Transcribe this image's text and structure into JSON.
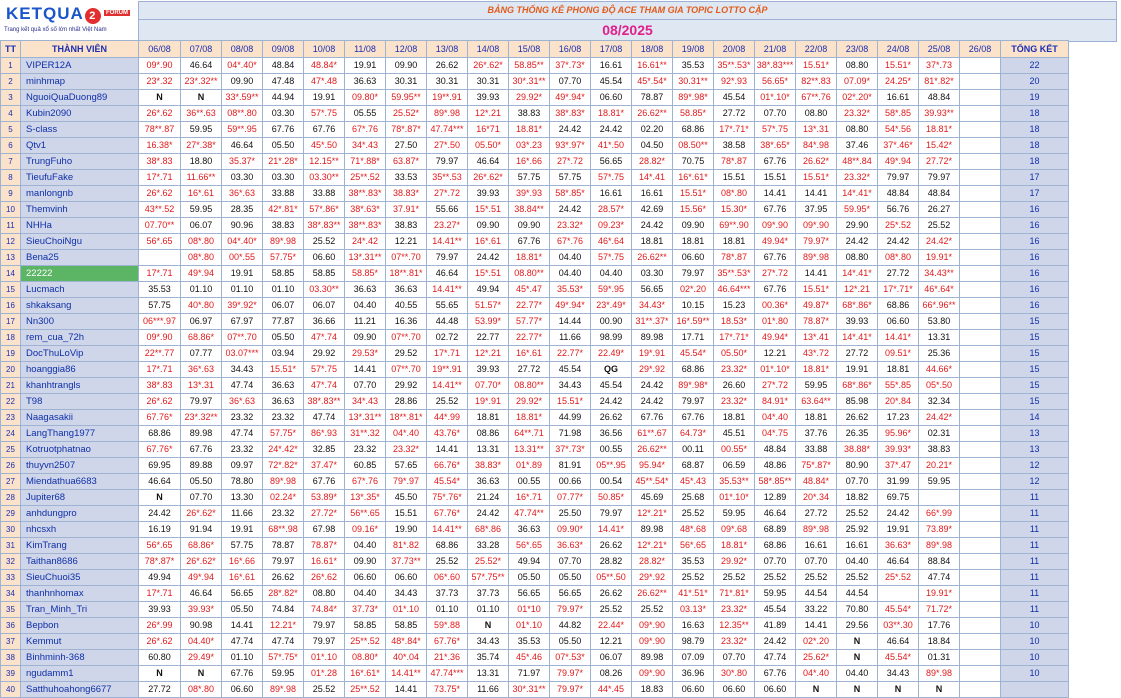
{
  "logo": {
    "brand": "KETQUA",
    "brand_num": "2",
    "forum": "FORUM",
    "tagline": "Trang kết quả xổ số lớn nhất Việt Nam"
  },
  "title": "BẢNG THỐNG KÊ PHONG ĐỘ ACE THAM GIA TOPIC  LOTTO CẶP",
  "month": "08/2025",
  "headers": {
    "tt": "TT",
    "member": "THÀNH VIÊN",
    "total": "TỔNG KẾT",
    "dates": [
      "06/08",
      "07/08",
      "08/08",
      "09/08",
      "10/08",
      "11/08",
      "12/08",
      "13/08",
      "14/08",
      "15/08",
      "16/08",
      "17/08",
      "18/08",
      "19/08",
      "20/08",
      "21/08",
      "22/08",
      "23/08",
      "24/08",
      "25/08",
      "26/08"
    ]
  },
  "colors": {
    "hit": "#e0191b",
    "miss": "#111111",
    "header_bg": "#fbe2cb",
    "name_bg": "#cfd6ea",
    "highlight": "#5cb565"
  },
  "rows": [
    {
      "tt": "1",
      "name": "VIPER12A",
      "cells": [
        "09*.90",
        "46.64",
        "04*.40*",
        "48.84",
        "48.84*",
        "19.91",
        "09.90",
        "26.62",
        "26*.62*",
        "58.85**",
        "37*.73*",
        "16.61",
        "16.61**",
        "35.53",
        "35**.53*",
        "38*.83***",
        "15.51*",
        "08.80",
        "15.51*",
        "37*.73",
        ""
      ],
      "total": "22"
    },
    {
      "tt": "2",
      "name": "minhmap",
      "cells": [
        "23*.32",
        "23*.32**",
        "09.90",
        "47.48",
        "47*.48",
        "36.63",
        "30.31",
        "30.31",
        "30.31",
        "30*.31**",
        "07.70",
        "45.54",
        "45*.54*",
        "30.31**",
        "92*.93",
        "56.65*",
        "82**.83",
        "07.09*",
        "24.25*",
        "81*.82*",
        ""
      ],
      "total": "20"
    },
    {
      "tt": "3",
      "name": "NguoiQuaDuong89",
      "cells": [
        "N",
        "N",
        "33*.59**",
        "44.94",
        "19.91",
        "09.80*",
        "59.95**",
        "19**.91",
        "39.93",
        "29.92*",
        "49*.94*",
        "06.60",
        "78.87",
        "89*.98*",
        "45.54",
        "01*.10*",
        "67**.76",
        "02*.20*",
        "16.61",
        "48.84",
        ""
      ],
      "total": "19"
    },
    {
      "tt": "4",
      "name": "Kubin2090",
      "cells": [
        "26*.62",
        "36**.63",
        "08**.80",
        "03.30",
        "57*.75",
        "05.55",
        "25.52*",
        "89*.98",
        "12*.21",
        "38.83",
        "38*.83*",
        "18.81*",
        "26.62**",
        "58.85*",
        "27.72",
        "07.70",
        "08.80",
        "23.32*",
        "58*.85",
        "39.93**",
        ""
      ],
      "total": "18"
    },
    {
      "tt": "5",
      "name": "S-class",
      "cells": [
        "78**.87",
        "59.95",
        "59**.95",
        "67.76",
        "67.76",
        "67*.76",
        "78*.87*",
        "47.74***",
        "16*71",
        "18.81*",
        "24.42",
        "24.42",
        "02.20",
        "68.86",
        "17*.71*",
        "57*.75",
        "13*.31",
        "08.80",
        "54*.56",
        "18.81*",
        ""
      ],
      "total": "18"
    },
    {
      "tt": "6",
      "name": "Qtv1",
      "cells": [
        "16.38*",
        "27*.38*",
        "46.64",
        "05.50",
        "45*.50",
        "34*.43",
        "27.50",
        "27*.50",
        "05.50*",
        "03*.23",
        "93*.97*",
        "41*.50",
        "04.50",
        "08.50**",
        "38.58",
        "38*.65*",
        "84*.98",
        "37.46",
        "37*.46*",
        "15.42*",
        ""
      ],
      "total": "18"
    },
    {
      "tt": "7",
      "name": "TrungFuho",
      "cells": [
        "38*.83",
        "18.80",
        "35.37*",
        "21*.28*",
        "12.15**",
        "71*.88*",
        "63.87*",
        "79.97",
        "46.64",
        "16*.66",
        "27*.72",
        "56.65",
        "28.82*",
        "70.75",
        "78*.87",
        "67.76",
        "26.62*",
        "48**.84",
        "49*.94",
        "27.72*",
        ""
      ],
      "total": "18"
    },
    {
      "tt": "8",
      "name": "TieufuFake",
      "cells": [
        "17*.71",
        "11.66**",
        "03.30",
        "03.30",
        "03.30**",
        "25**.52",
        "33.53",
        "35**.53",
        "26*.62*",
        "57.75",
        "57.75",
        "57*.75",
        "14*.41",
        "16*.61*",
        "15.51",
        "15.51",
        "15.51*",
        "23.32*",
        "79.97",
        "79.97",
        ""
      ],
      "total": "17"
    },
    {
      "tt": "9",
      "name": "manlongnb",
      "cells": [
        "26*.62",
        "16*.61",
        "36*.63",
        "33.88",
        "33.88",
        "38**.83*",
        "38.83*",
        "27*.72",
        "39.93",
        "39*.93",
        "58*.85*",
        "16.61",
        "16.61",
        "15.51*",
        "08*.80",
        "14.41",
        "14.41",
        "14*.41*",
        "48.84",
        "48.84",
        ""
      ],
      "total": "17"
    },
    {
      "tt": "10",
      "name": "Themvinh",
      "cells": [
        "43**.52",
        "59.95",
        "28.35",
        "42*.81*",
        "57*.86*",
        "38*.63*",
        "37.91*",
        "55.66",
        "15*.51",
        "38.84**",
        "24.42",
        "28.57*",
        "42.69",
        "15.56*",
        "15.30*",
        "67.76",
        "37.95",
        "59.95*",
        "56.76",
        "26.27",
        ""
      ],
      "total": "16"
    },
    {
      "tt": "11",
      "name": "NHHa",
      "cells": [
        "07.70**",
        "06.07",
        "90.96",
        "38.83",
        "38*.83**",
        "38**.83*",
        "38.83",
        "23.27*",
        "09.90",
        "09.90",
        "23.32*",
        "09.23*",
        "24.42",
        "09.90",
        "69**.90",
        "09*.90",
        "09*.90",
        "29.90",
        "25*.52",
        "25.52",
        ""
      ],
      "total": "16"
    },
    {
      "tt": "12",
      "name": "SieuChoiNgu",
      "cells": [
        "56*.65",
        "08*.80",
        "04*.40*",
        "89*.98",
        "25.52",
        "24*.42",
        "12.21",
        "14.41**",
        "16*.61",
        "67.76",
        "67*.76",
        "46*.64",
        "18.81",
        "18.81",
        "18.81",
        "49.94*",
        "79.97*",
        "24.42",
        "24.42",
        "24.42*",
        ""
      ],
      "total": "16"
    },
    {
      "tt": "13",
      "name": "Bena25",
      "cells": [
        "",
        "08*.80",
        "00*.55",
        "57.75*",
        "06.60",
        "13*.31**",
        "07**.70",
        "79.97",
        "24.42",
        "18.81*",
        "04.40",
        "57*.75",
        "26.62**",
        "06.60",
        "78*.87",
        "67.76",
        "89*.98",
        "08.80",
        "08*.80",
        "19.91*",
        ""
      ],
      "total": "16"
    },
    {
      "tt": "14",
      "name": "22222",
      "hl": true,
      "cells": [
        "17*.71",
        "49*.94",
        "19.91",
        "58.85",
        "58.85",
        "58.85*",
        "18**.81*",
        "46.64",
        "15*.51",
        "08.80**",
        "04.40",
        "04.40",
        "03.30",
        "79.97",
        "35**.53*",
        "27*.72",
        "14.41",
        "14*.41*",
        "27.72",
        "34.43**",
        ""
      ],
      "total": "16"
    },
    {
      "tt": "15",
      "name": "Lucmach",
      "cells": [
        "35.53",
        "01.10",
        "01.10",
        "01.10",
        "03.30**",
        "36.63",
        "36.63",
        "14.41**",
        "49.94",
        "45*.47",
        "35.53*",
        "59*.95",
        "56.65",
        "02*.20",
        "46.64***",
        "67.76",
        "15.51*",
        "12*.21",
        "17*.71*",
        "46*.64*",
        ""
      ],
      "total": "16"
    },
    {
      "tt": "16",
      "name": "shkaksang",
      "cells": [
        "57.75",
        "40*.80",
        "39*.92*",
        "06.07",
        "06.07",
        "04.40",
        "40.55",
        "55.65",
        "51.57*",
        "22.77*",
        "49*.94*",
        "23*.49*",
        "34.43*",
        "10.15",
        "15.23",
        "00.36*",
        "49.87*",
        "68*.86*",
        "68.86",
        "66*.96**",
        ""
      ],
      "total": "16"
    },
    {
      "tt": "17",
      "name": "Nn300",
      "cells": [
        "06***.97",
        "06.97",
        "67.97",
        "77.87",
        "36.66",
        "11.21",
        "16.36",
        "44.48",
        "53.99*",
        "57.77*",
        "14.44",
        "00.90",
        "31**.37*",
        "16*.59**",
        "18.53*",
        "01*.80",
        "78.87*",
        "39.93",
        "06.60",
        "53.80",
        ""
      ],
      "total": "15"
    },
    {
      "tt": "18",
      "name": "rem_cua_72h",
      "cells": [
        "09*.90",
        "68.86*",
        "07**.70",
        "05.50",
        "47*.74",
        "09.90",
        "07**.70",
        "02.72",
        "22.77",
        "22.77*",
        "11.66",
        "98.99",
        "89.98",
        "17.71",
        "17*.71*",
        "49.94*",
        "13*.41",
        "14*.41*",
        "14.41*",
        "13.31",
        ""
      ],
      "total": "15"
    },
    {
      "tt": "19",
      "name": "DocThuLoVip",
      "cells": [
        "22**.77",
        "07.77",
        "03.07***",
        "03.94",
        "29.92",
        "29.53*",
        "29.52",
        "17*.71",
        "12*.21",
        "16*.61",
        "22.77*",
        "22.49*",
        "19*.91",
        "45.54*",
        "05.50*",
        "12.21",
        "43*.72",
        "27.72",
        "09.51*",
        "25.36",
        ""
      ],
      "total": "15"
    },
    {
      "tt": "20",
      "name": "hoanggia86",
      "cells": [
        "17*.71",
        "36*.63",
        "34.43",
        "15.51*",
        "57*.75",
        "14.41",
        "07**.70",
        "19**.91",
        "39.93",
        "27.72",
        "45.54",
        "QG",
        "29*.92",
        "68.86",
        "23.32*",
        "01*.10*",
        "18.81*",
        "19.91",
        "18.81",
        "44.66*",
        ""
      ],
      "total": "15"
    },
    {
      "tt": "21",
      "name": "khanhtrangls",
      "cells": [
        "38*.83",
        "13*.31",
        "47.74",
        "36.63",
        "47*.74",
        "07.70",
        "29.92",
        "14.41**",
        "07.70*",
        "08.80**",
        "34.43",
        "45.54",
        "24.42",
        "89*.98*",
        "26.60",
        "27*.72",
        "59.95",
        "68*.86*",
        "55*.85",
        "05*.50",
        ""
      ],
      "total": "15"
    },
    {
      "tt": "22",
      "name": "T98",
      "cells": [
        "26*.62",
        "79.97",
        "36*.63",
        "36.63",
        "38*.83**",
        "34*.43",
        "28.86",
        "25.52",
        "19*.91",
        "29.92*",
        "15.51*",
        "24.42",
        "24.42",
        "79.97",
        "23.32*",
        "84.91*",
        "63.64**",
        "85.98",
        "20*.84",
        "32.34",
        ""
      ],
      "total": "15"
    },
    {
      "tt": "23",
      "name": "Naagasakii",
      "cells": [
        "67.76*",
        "23*.32**",
        "23.32",
        "23.32",
        "47.74",
        "13*.31**",
        "18**.81*",
        "44*.99",
        "18.81",
        "18.81*",
        "44.99",
        "26.62",
        "67.76",
        "67.76",
        "18.81",
        "04*.40",
        "18.81",
        "26.62",
        "17.23",
        "24.42*",
        ""
      ],
      "total": "14"
    },
    {
      "tt": "24",
      "name": "LangThang1977",
      "cells": [
        "68.86",
        "89.98",
        "47.74",
        "57.75*",
        "86*.93",
        "31**.32",
        "04*.40",
        "43.76*",
        "08.86",
        "64**.71",
        "71.98",
        "36.56",
        "61**.67",
        "64.73*",
        "45.51",
        "04*.75",
        "37.76",
        "26.35",
        "95.96*",
        "02.31",
        ""
      ],
      "total": "13"
    },
    {
      "tt": "25",
      "name": "Kotruotphatnao",
      "cells": [
        "67.76*",
        "67.76",
        "23.32",
        "24*.42*",
        "32.85",
        "23.32",
        "23.32*",
        "14.41",
        "13.31",
        "13.31**",
        "37*.73*",
        "00.55",
        "26.62**",
        "00.11",
        "00.55*",
        "48.84",
        "33.88",
        "38.88*",
        "39.93*",
        "38.83",
        ""
      ],
      "total": "13"
    },
    {
      "tt": "26",
      "name": "thuyvn2507",
      "cells": [
        "69.95",
        "89.88",
        "09.97",
        "72*.82*",
        "37.47*",
        "60.85",
        "57.65",
        "66.76*",
        "38.83*",
        "01*.89",
        "81.91",
        "05**.95",
        "95.94*",
        "68.87",
        "06.59",
        "48.86",
        "75*.87*",
        "80.90",
        "37*.47",
        "20.21*",
        ""
      ],
      "total": "12"
    },
    {
      "tt": "27",
      "name": "Miendathua6683",
      "cells": [
        "46.64",
        "05.50",
        "78.80",
        "89*.98",
        "67.76",
        "67*.76",
        "79*.97",
        "45.54*",
        "36.63",
        "00.55",
        "00.66",
        "00.54",
        "45**.54*",
        "45*.43",
        "35.53**",
        "58*.85**",
        "48.84*",
        "07.70",
        "31.99",
        "59.95",
        ""
      ],
      "total": "12"
    },
    {
      "tt": "28",
      "name": "Jupiter68",
      "cells": [
        "N",
        "07.70",
        "13.30",
        "02.24*",
        "53.89*",
        "13*.35*",
        "45.50",
        "75*.76*",
        "21.24",
        "16*.71",
        "07.77*",
        "50.85*",
        "45.69",
        "25.68",
        "01*.10*",
        "12.89",
        "20*.34",
        "18.82",
        "69.75",
        ""
      ],
      "total": "11"
    },
    {
      "tt": "29",
      "name": "anhdungpro",
      "cells": [
        "24.42",
        "26*.62*",
        "11.66",
        "23.32",
        "27.72*",
        "56**.65",
        "15.51",
        "67.76*",
        "24.42",
        "47.74**",
        "25.50",
        "79.97",
        "12*.21*",
        "25.52",
        "59.95",
        "46.64",
        "27.72",
        "25.52",
        "24.42",
        "66*.99",
        ""
      ],
      "total": "11"
    },
    {
      "tt": "30",
      "name": "nhcsxh",
      "cells": [
        "16.19",
        "91.94",
        "19.91",
        "68**.98",
        "67.98",
        "09.16*",
        "19.90",
        "14.41**",
        "68*.86",
        "36.63",
        "09.90*",
        "14.41*",
        "89.98",
        "48*.68",
        "09*.68",
        "68.89",
        "89*.98",
        "25.92",
        "19.91",
        "73.89*",
        ""
      ],
      "total": "11"
    },
    {
      "tt": "31",
      "name": "KimTrang",
      "cells": [
        "56*.65",
        "68.86*",
        "57.75",
        "78.87",
        "78.87*",
        "04.40",
        "81*.82",
        "68.86",
        "33.28",
        "56*.65",
        "36.63*",
        "26.62",
        "12*.21*",
        "56*.65",
        "18.81*",
        "68.86",
        "16.61",
        "16.61",
        "36.63*",
        "89*.98",
        ""
      ],
      "total": "11"
    },
    {
      "tt": "32",
      "name": "Taithan8686",
      "cells": [
        "78*.87*",
        "26*.62*",
        "16*.66",
        "79.97",
        "16.61*",
        "09.90",
        "37.73**",
        "25.52",
        "25.52*",
        "49.94",
        "07.70",
        "28.82",
        "28.82*",
        "35.53",
        "29.92*",
        "07.70",
        "07.70",
        "04.40",
        "46.64",
        "88.84",
        ""
      ],
      "total": "11"
    },
    {
      "tt": "33",
      "name": "SieuChuoi35",
      "cells": [
        "49.94",
        "49*.94",
        "16*.61",
        "26.62",
        "26*.62",
        "06.60",
        "06.60",
        "06*.60",
        "57*.75**",
        "05.50",
        "05.50",
        "05**.50",
        "29*.92",
        "25.52",
        "25.52",
        "25.52",
        "25.52",
        "25.52",
        "25*.52",
        "47.74",
        ""
      ],
      "total": "11"
    },
    {
      "tt": "34",
      "name": "thanhnhomax",
      "cells": [
        "17*.71",
        "46.64",
        "56.65",
        "28*.82*",
        "08.80",
        "04.40",
        "34.43",
        "37.73",
        "37.73",
        "56.65",
        "56.65",
        "26.62",
        "26.62**",
        "41*.51*",
        "71*.81*",
        "59.95",
        "44.54",
        "44.54",
        "",
        "19.91*",
        ""
      ],
      "total": "11"
    },
    {
      "tt": "35",
      "name": "Tran_Minh_Tri",
      "cells": [
        "39.93",
        "39.93*",
        "05.50",
        "74.84",
        "74.84*",
        "37.73*",
        "01*.10",
        "01.10",
        "01.10",
        "01*10",
        "79.97*",
        "25.52",
        "25.52",
        "03.13*",
        "23.32*",
        "45.54",
        "33.22",
        "70.80",
        "45.54*",
        "71.72*",
        ""
      ],
      "total": "11"
    },
    {
      "tt": "36",
      "name": "Bepbon",
      "cells": [
        "26*.99",
        "90.98",
        "14.41",
        "12.21*",
        "79.97",
        "58.85",
        "58.85",
        "59*.88",
        "N",
        "01*.10",
        "44.82",
        "22.44*",
        "09*.90",
        "16.63",
        "12.35**",
        "41.89",
        "14.41",
        "29.56",
        "03**.30",
        "17.76",
        ""
      ],
      "total": "10"
    },
    {
      "tt": "37",
      "name": "Kemmut",
      "cells": [
        "26*.62",
        "04.40*",
        "47.74",
        "47.74",
        "79.97",
        "25**.52",
        "48*.84*",
        "67.76*",
        "34.43",
        "35.53",
        "05.50",
        "12.21",
        "09*.90",
        "98.79",
        "23.32*",
        "24.42",
        "02*.20",
        "N",
        "46.64",
        "18.84",
        ""
      ],
      "total": "10"
    },
    {
      "tt": "38",
      "name": "Binhminh-368",
      "cells": [
        "60.80",
        "29.49*",
        "01.10",
        "57*.75*",
        "01*.10",
        "08.80*",
        "40*.04",
        "21*.36",
        "35.74",
        "45*.46",
        "07*.53*",
        "06.07",
        "89.98",
        "07.09",
        "07.70",
        "47.74",
        "25.62*",
        "N",
        "45.54*",
        "01.31",
        ""
      ],
      "total": "10"
    },
    {
      "tt": "39",
      "name": "ngudamm1",
      "cells": [
        "N",
        "N",
        "67.76",
        "59.95",
        "01*.28",
        "16*.61*",
        "14.41**",
        "47.74***",
        "13.31",
        "71.97",
        "79.97*",
        "08.26",
        "09*.90",
        "36.96",
        "30*.80",
        "67.76",
        "04*.40",
        "04.40",
        "34.43",
        "89*.98",
        ""
      ],
      "total": "10"
    },
    {
      "tt": "40",
      "name": "Satthuhoahong6677",
      "cells": [
        "27.72",
        "08*.80",
        "06.60",
        "89*.98",
        "25.52",
        "25**.52",
        "14.41",
        "73.75*",
        "11.66",
        "30*.31**",
        "79.97*",
        "44*.45",
        "18.83",
        "06.60",
        "06.60",
        "06.60",
        "N",
        "N",
        "N",
        "N",
        ""
      ],
      "total": ""
    }
  ]
}
